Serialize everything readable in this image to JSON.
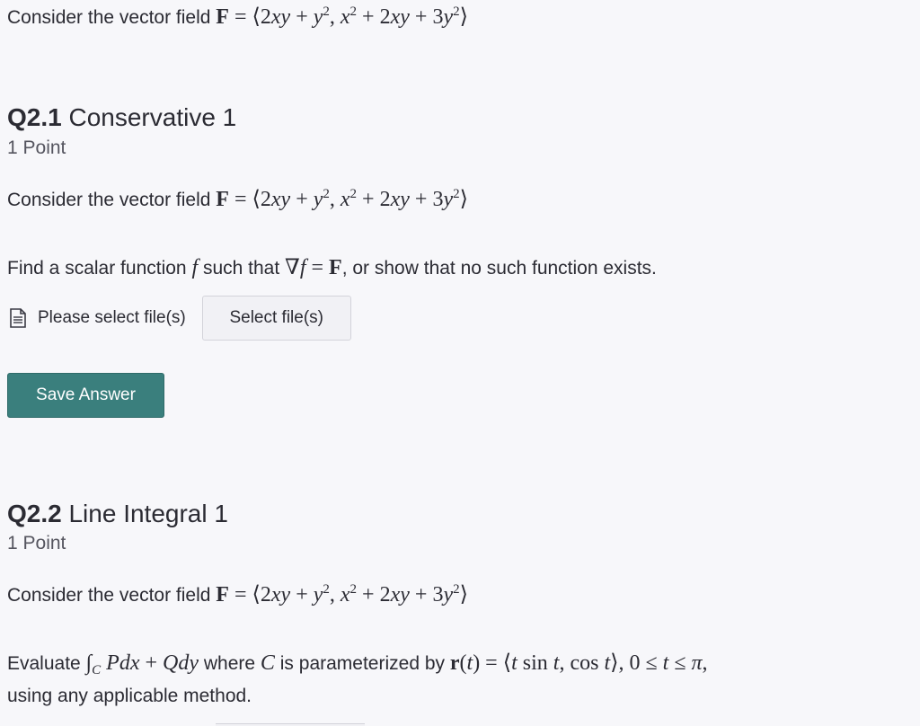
{
  "header": {
    "intro_text": "Consider the vector field",
    "field_eq": "= ⟨2xy + y², x² + 2xy + 3y²⟩"
  },
  "questions": [
    {
      "number": "Q2.1",
      "title": "Conservative 1",
      "points": "1 Point",
      "intro_text": "Consider the vector field",
      "prompt_a": "Find a scalar function",
      "prompt_b": "such that",
      "prompt_c": ", or show that no such function exists.",
      "file_status": "Please select file(s)",
      "select_button": "Select file(s)",
      "save_button": "Save Answer"
    },
    {
      "number": "Q2.2",
      "title": "Line Integral 1",
      "points": "1 Point",
      "intro_text": "Consider the vector field",
      "prompt_a": "Evaluate",
      "prompt_b": "where",
      "prompt_c": "is parameterized by",
      "prompt_d": "using any applicable method."
    }
  ],
  "icons": {
    "file": "document-icon"
  },
  "colors": {
    "save_button_bg": "#3a7f7d",
    "page_bg": "#f7f7fa"
  }
}
